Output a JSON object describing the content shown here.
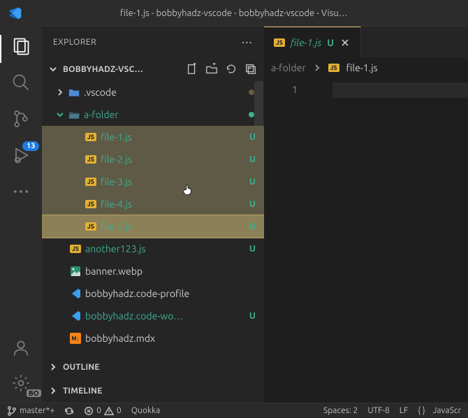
{
  "title": "file-1.js - bobbyhadz-vscode - bobbyhadz-vscode - Visu…",
  "explorer": {
    "label": "EXPLORER",
    "workspace": "BOBBYHADZ-VSC…",
    "outline": "OUTLINE",
    "timeline": "TIMELINE"
  },
  "tree": {
    "vscode": ".vscode",
    "afolder": "a-folder",
    "files": [
      "file-1.js",
      "file-2.js",
      "file-3.js",
      "file-4.js",
      "file-5.js"
    ],
    "u": "U",
    "another": "another123.js",
    "banner": "banner.webp",
    "profile": "bobbyhadz.code-profile",
    "workspace_file": "bobbyhadz.code-wo…",
    "mdx": "bobbyhadz.mdx"
  },
  "tab": {
    "name": "file-1.js",
    "u": "U"
  },
  "breadcrumb": {
    "folder": "a-folder",
    "file": "file-1.js"
  },
  "gutter": {
    "line1": "1"
  },
  "activity": {
    "badge": "13",
    "bo": "BO"
  },
  "status": {
    "branch": "master*+",
    "errors": "0",
    "warnings": "0",
    "quokka": "Quokka",
    "spaces": "Spaces: 2",
    "encoding": "UTF-8",
    "eol": "LF",
    "lang": "JavaScr"
  }
}
